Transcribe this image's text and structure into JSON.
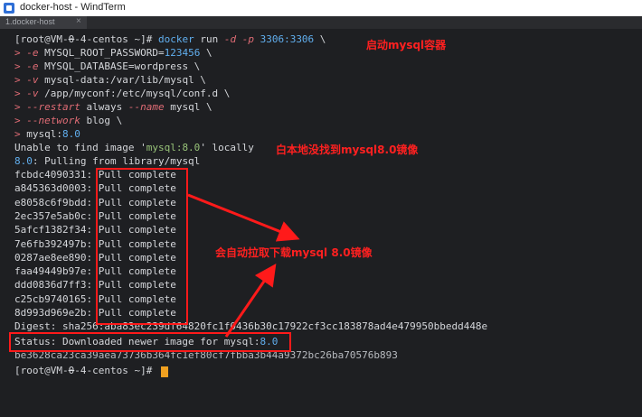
{
  "window": {
    "title": "docker-host - WindTerm"
  },
  "tab": {
    "label": "1.docker-host",
    "close": "×"
  },
  "prompt_open": "[root@VM-",
  "prompt_host": "0",
  "prompt_rest": "-4-centos ~]# ",
  "command": {
    "parts": [
      "docker",
      " run ",
      "-d",
      " ",
      "-p",
      " ",
      "3306:3306",
      " \\"
    ],
    "continuations": [
      {
        "flag": "-e",
        "arg": " MYSQL_ROOT_PASSWORD=",
        "val": "123456",
        "tail": " \\"
      },
      {
        "flag": "-e",
        "arg": " MYSQL_DATABASE=wordpress \\",
        "val": "",
        "tail": ""
      },
      {
        "flag": "-v",
        "arg": " mysql-data:/var/lib/mysql \\",
        "val": "",
        "tail": ""
      },
      {
        "flag": "-v",
        "arg": " /app/myconf:/etc/mysql/conf.d \\",
        "val": "",
        "tail": ""
      },
      {
        "flag": "--restart",
        "arg": " always ",
        "val": "--name",
        "tail": " mysql \\"
      },
      {
        "flag": "--network",
        "arg": " blog \\",
        "val": "",
        "tail": ""
      },
      {
        "flag": "",
        "arg": "mysql:",
        "val": "8.0",
        "tail": ""
      }
    ]
  },
  "output": {
    "unable_pre": "Unable to find image '",
    "unable_img": "mysql:8.0",
    "unable_post": "' locally",
    "pulling_tag": "8.0",
    "pulling_rest": ": Pulling from library/mysql",
    "layers": [
      {
        "id": "fcbdc4090331",
        "status": "Pull complete"
      },
      {
        "id": "a845363d0003",
        "status": "Pull complete"
      },
      {
        "id": "e8058c6f9bdd",
        "status": "Pull complete"
      },
      {
        "id": "2ec357e5ab0c",
        "status": "Pull complete"
      },
      {
        "id": "5afcf1382f34",
        "status": "Pull complete"
      },
      {
        "id": "7e6fb392497b",
        "status": "Pull complete"
      },
      {
        "id": "0287ae8ee890",
        "status": "Pull complete"
      },
      {
        "id": "faa49449b97e",
        "status": "Pull complete"
      },
      {
        "id": "ddd0836d7ff3",
        "status": "Pull complete"
      },
      {
        "id": "c25cb9740165",
        "status": "Pull complete"
      },
      {
        "id": "8d993d969e2b",
        "status": "Pull complete"
      }
    ],
    "digest": "Digest: sha256:aba83ec239df64820fc1f0436b30c17922cf3cc183878ad4e479950bbedd448e",
    "status_pre": "Status: Downloaded newer image for mysql:",
    "status_tag": "8.0",
    "image_id": "be3628ca23ca39aea73736b364fc1ef80cf7fbba3b44a9372bc26ba70576b893"
  },
  "annotations": {
    "start": "启动mysql容器",
    "not_found": "白本地没找到mysql8.0镜像",
    "auto_pull": "会自动拉取下载mysql 8.0镜像"
  },
  "colors": {
    "annotation": "#ff2020",
    "cursor": "#f0a020",
    "background": "#1e1f22"
  }
}
